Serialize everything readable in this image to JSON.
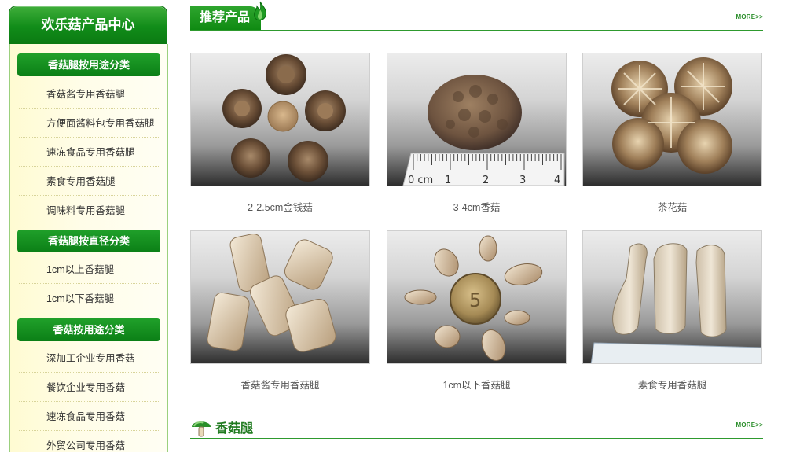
{
  "sidebar": {
    "title": "欢乐菇产品中心",
    "categories": [
      {
        "name": "香菇腿按用途分类",
        "items": [
          "香菇酱专用香菇腿",
          "方便面酱料包专用香菇腿",
          "速冻食品专用香菇腿",
          "素食专用香菇腿",
          "调味料专用香菇腿"
        ]
      },
      {
        "name": "香菇腿按直径分类",
        "items": [
          "1cm以上香菇腿",
          "1cm以下香菇腿"
        ]
      },
      {
        "name": "香菇按用途分类",
        "items": [
          "深加工企业专用香菇",
          "餐饮企业专用香菇",
          "速冻食品专用香菇",
          "外贸公司专用香菇"
        ]
      }
    ]
  },
  "recommended": {
    "title": "推荐产品",
    "more": "MORE>>",
    "products": [
      {
        "name": "2-2.5cm金钱菇",
        "image_icon": "shiitake-coins-photo"
      },
      {
        "name": "3-4cm香菇",
        "image_icon": "shiitake-with-ruler-photo"
      },
      {
        "name": "茶花菇",
        "image_icon": "flower-mushroom-photo"
      },
      {
        "name": "香菇酱专用香菇腿",
        "image_icon": "mushroom-stems-photo"
      },
      {
        "name": "1cm以下香菇腿",
        "image_icon": "small-stems-coin-photo"
      },
      {
        "name": "素食专用香菇腿",
        "image_icon": "long-stems-ruler-photo"
      }
    ]
  },
  "stems_section": {
    "title": "香菇腿",
    "more": "MORE>>"
  },
  "ruler_labels": [
    "0 cm",
    "1",
    "2",
    "3",
    "4"
  ],
  "coin_label": "5",
  "colors": {
    "brand_green": "#118c19",
    "sidebar_bg": "#fffbd2",
    "accent_line": "#2e9a2e"
  }
}
